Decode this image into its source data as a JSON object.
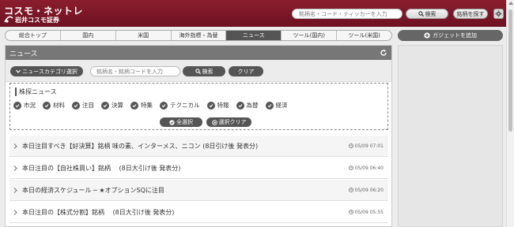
{
  "header": {
    "logo_main": "コスモ・ネットレ",
    "logo_sub": "岩井コスモ証券",
    "search_placeholder": "銘柄名・コード・ティッカーを入力",
    "search_label": "検索",
    "find_label": "銘柄を探す"
  },
  "tabs": [
    {
      "label": "総合トップ"
    },
    {
      "label": "国内"
    },
    {
      "label": "米国"
    },
    {
      "label": "海外指標・為替"
    },
    {
      "label": "ニュース",
      "active": true
    },
    {
      "label": "ツール(国内)"
    },
    {
      "label": "ツール(米国)"
    }
  ],
  "gadget_label": "ガジェットを追加",
  "panel": {
    "title": "ニュース",
    "category_label": "ニュースカテゴリ選択",
    "keyword_placeholder": "銘柄名・銘柄コードを入力",
    "search_label": "検索",
    "clear_label": "クリア",
    "filter_title": "株探ニュース",
    "filters": [
      "市況",
      "材料",
      "注目",
      "決算",
      "特集",
      "テクニカル",
      "特報",
      "為替",
      "経済"
    ],
    "select_all_label": "全選択",
    "clear_selection_label": "選択クリア"
  },
  "news": [
    {
      "title": "本日注目すべき【好決算】銘柄 味の素、インターメス、ニコン (8日引け後 発表分)",
      "time": "05/09 07:01"
    },
    {
      "title": "本日注目の【自社株買い】銘柄 　(8日大引け後 発表分)",
      "time": "05/09 06:40"
    },
    {
      "title": "本日の経済スケジュール ─ ★オプションSQに注目",
      "time": "05/09 06:20"
    },
    {
      "title": "本日注目の【株式分割】銘柄 　(8日大引け後 発表分)",
      "time": "05/09 05:55"
    }
  ],
  "colors": {
    "brand": "#7a1626",
    "dark": "#555555"
  }
}
